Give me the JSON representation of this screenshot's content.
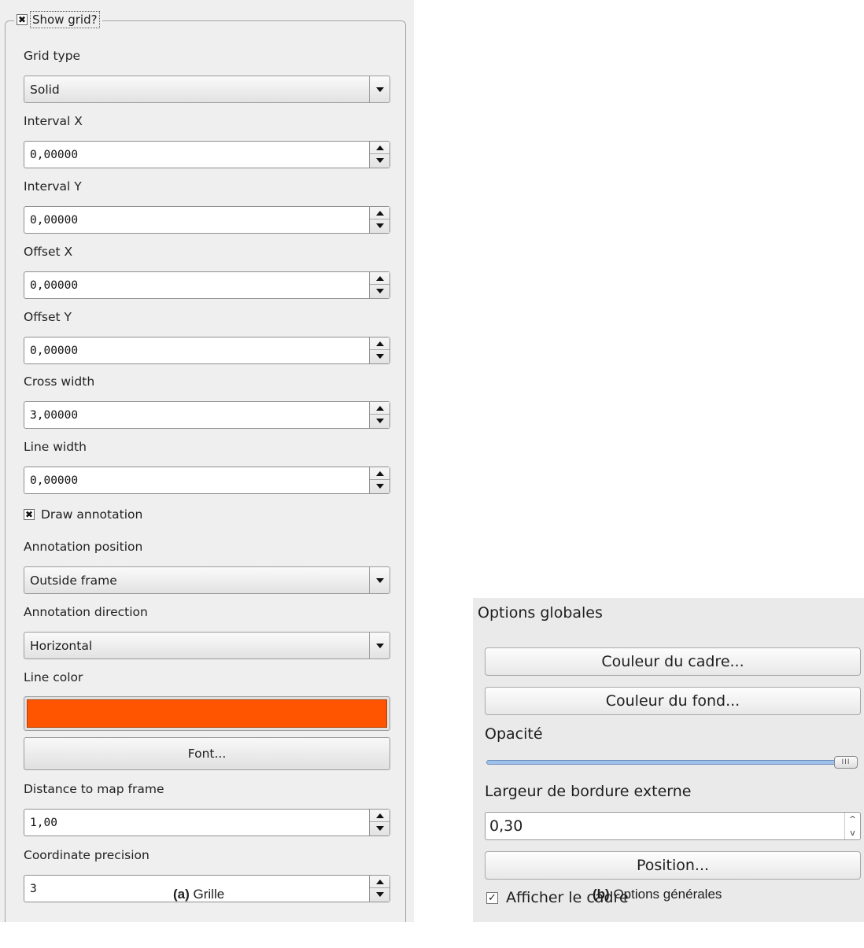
{
  "grid_panel": {
    "show_grid_label": "Show grid?",
    "show_grid_checked": "✖",
    "grid_type_label": "Grid type",
    "grid_type_value": "Solid",
    "interval_x_label": "Interval X",
    "interval_x_value": "0,00000",
    "interval_y_label": "Interval Y",
    "interval_y_value": "0,00000",
    "offset_x_label": "Offset X",
    "offset_x_value": "0,00000",
    "offset_y_label": "Offset Y",
    "offset_y_value": "0,00000",
    "cross_width_label": "Cross width",
    "cross_width_value": "3,00000",
    "line_width_label": "Line width",
    "line_width_value": "0,00000",
    "draw_annotation_label": "Draw annotation",
    "draw_annotation_checked": "✖",
    "annotation_position_label": "Annotation position",
    "annotation_position_value": "Outside frame",
    "annotation_direction_label": "Annotation direction",
    "annotation_direction_value": "Horizontal",
    "line_color_label": "Line color",
    "line_color": "#ff5500",
    "font_button": "Font...",
    "distance_label": "Distance to map frame",
    "distance_value": "1,00",
    "precision_label": "Coordinate precision",
    "precision_value": "3"
  },
  "options_panel": {
    "title": "Options globales",
    "frame_color_button": "Couleur du cadre...",
    "background_color_button": "Couleur du fond...",
    "opacity_label": "Opacité",
    "opacity_value": 1.0,
    "slider_grip": "III",
    "outline_width_label": "Largeur de bordure externe",
    "outline_width_value": "0,30",
    "spin_up": "^",
    "spin_down": "v",
    "position_button": "Position...",
    "show_frame_label": "Afficher le cadre",
    "show_frame_checked": "✓"
  },
  "captions": {
    "a_tag": "(a)",
    "a_text": " Grille",
    "b_tag": "(b)",
    "b_text": " Options générales"
  },
  "colors": {
    "accent_slider": "#9fc0e8",
    "line_color": "#ff5500"
  }
}
